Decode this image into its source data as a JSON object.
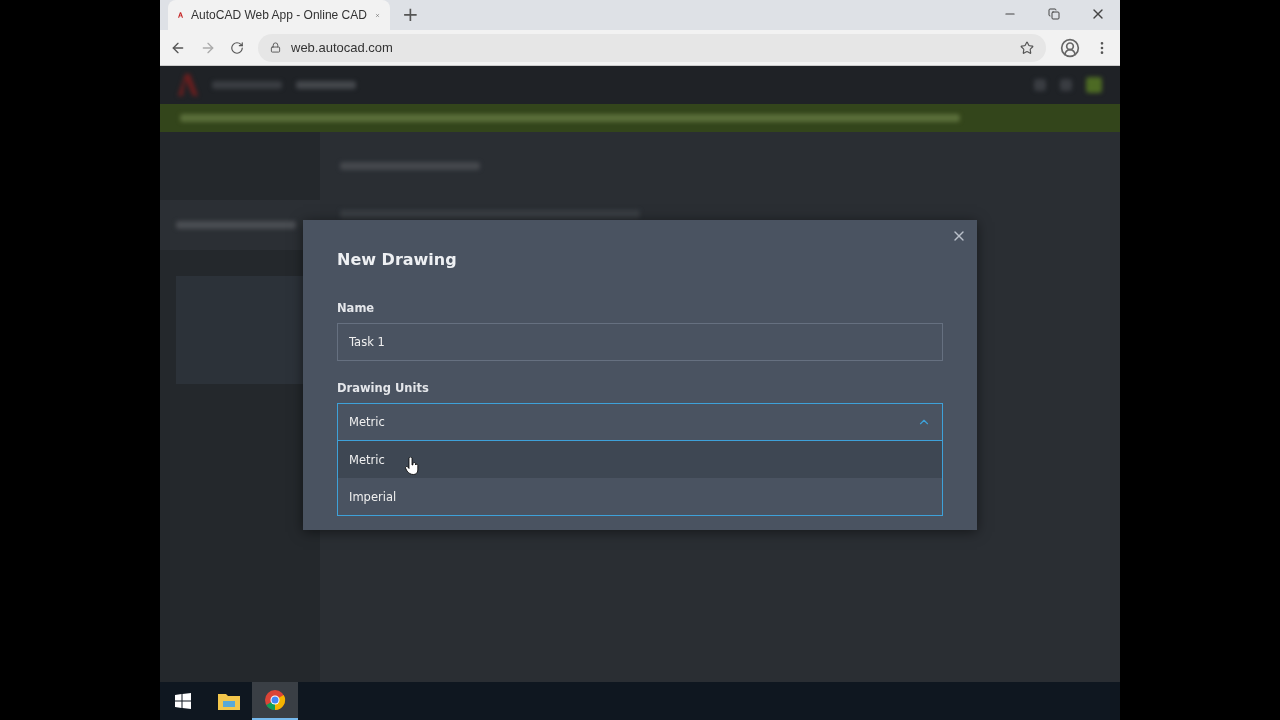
{
  "browser": {
    "tab_title": "AutoCAD Web App - Online CAD",
    "new_tab": "+",
    "url": "web.autocad.com"
  },
  "dialog": {
    "title": "New Drawing",
    "name_label": "Name",
    "name_value": "Task 1",
    "units_label": "Drawing Units",
    "units_value": "Metric",
    "expanded": true,
    "options": [
      {
        "label": "Metric",
        "selected": true
      },
      {
        "label": "Imperial",
        "selected": false
      }
    ]
  },
  "taskbar": {
    "items": [
      {
        "kind": "start",
        "selected": false
      },
      {
        "kind": "folder",
        "selected": false
      },
      {
        "kind": "browser",
        "selected": true
      }
    ]
  }
}
